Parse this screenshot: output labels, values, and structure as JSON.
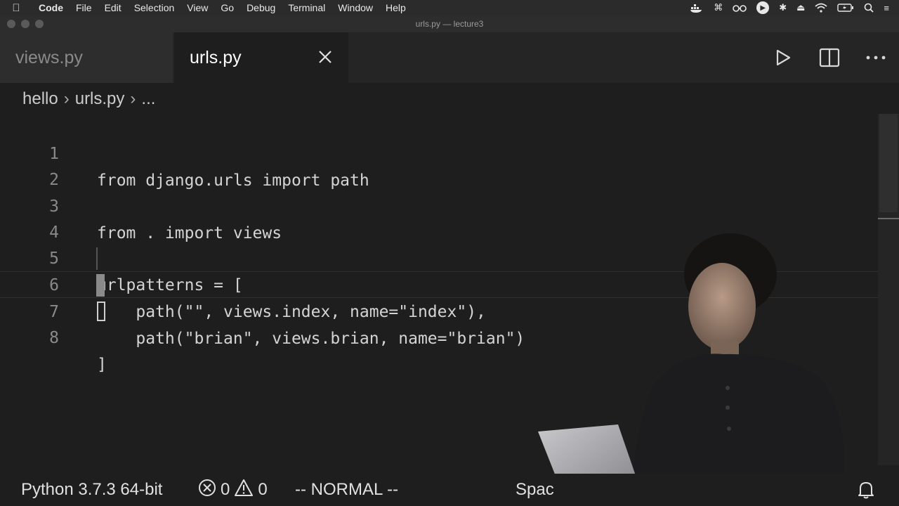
{
  "menubar": {
    "apple_icon": "apple-icon",
    "items": [
      "Code",
      "File",
      "Edit",
      "Selection",
      "View",
      "Go",
      "Debug",
      "Terminal",
      "Window",
      "Help"
    ]
  },
  "window": {
    "title": "urls.py — lecture3"
  },
  "tabs": [
    {
      "label": "views.py",
      "active": false
    },
    {
      "label": "urls.py",
      "active": true
    }
  ],
  "breadcrumb": {
    "items": [
      "hello",
      "urls.py",
      "..."
    ]
  },
  "editor": {
    "lines": [
      {
        "number": "1",
        "text": "from django.urls import path"
      },
      {
        "number": "2",
        "text": ""
      },
      {
        "number": "3",
        "text": "from . import views"
      },
      {
        "number": "4",
        "text": ""
      },
      {
        "number": "5",
        "text": "urlpatterns = ["
      },
      {
        "number": "6",
        "text": "    path(\"\", views.index, name=\"index\"),"
      },
      {
        "number": "7",
        "text": "    path(\"brian\", views.brian, name=\"brian\")"
      },
      {
        "number": "8",
        "text": "]"
      }
    ],
    "active_line": 7
  },
  "statusbar": {
    "python": "Python 3.7.3 64-bit",
    "errors": "0",
    "warnings": "0",
    "mode": "-- NORMAL --",
    "spaces": "Spac"
  },
  "colors": {
    "background": "#1e1e1e",
    "tabbar": "#252526",
    "text": "#d4d4d4"
  }
}
